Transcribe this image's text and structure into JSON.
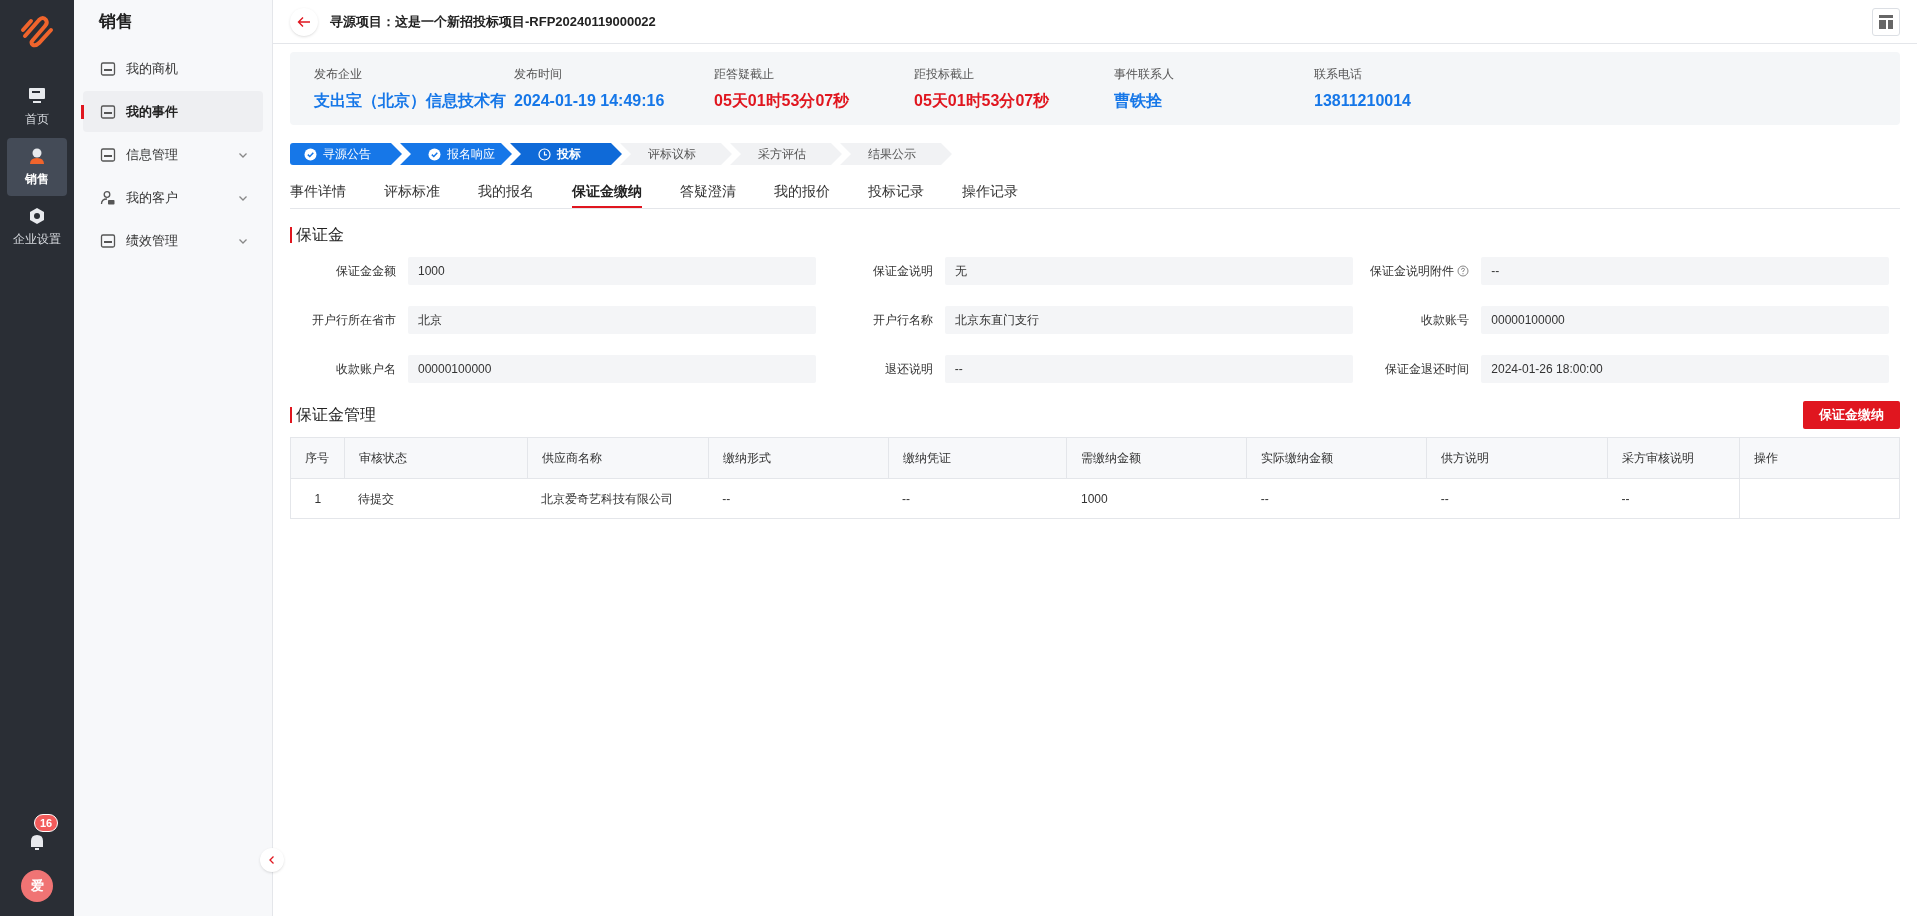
{
  "rail": {
    "items": [
      {
        "label": "首页",
        "selected": false
      },
      {
        "label": "销售",
        "selected": true
      },
      {
        "label": "企业设置",
        "selected": false
      }
    ],
    "notifications": {
      "count": "16"
    },
    "avatar": {
      "initial": "爱"
    }
  },
  "sidebar": {
    "title": "销售",
    "items": [
      {
        "label": "我的商机",
        "selected": false,
        "expandable": false
      },
      {
        "label": "我的事件",
        "selected": true,
        "expandable": false
      },
      {
        "label": "信息管理",
        "selected": false,
        "expandable": true
      },
      {
        "label": "我的客户",
        "selected": false,
        "expandable": true
      },
      {
        "label": "绩效管理",
        "selected": false,
        "expandable": true
      }
    ]
  },
  "header": {
    "title": "寻源项目：这是一个新招投标项目-RFP20240119000022"
  },
  "info": [
    {
      "label": "发布企业",
      "value": "支出宝（北京）信息技术有",
      "color": "#1677e8"
    },
    {
      "label": "发布时间",
      "value": "2024-01-19 14:49:16",
      "color": "#1677e8"
    },
    {
      "label": "距答疑截止",
      "value": "05天01时53分07秒",
      "color": "#e0161f"
    },
    {
      "label": "距投标截止",
      "value": "05天01时53分07秒",
      "color": "#e0161f"
    },
    {
      "label": "事件联系人",
      "value": "曹铁拴",
      "color": "#1677e8"
    },
    {
      "label": "联系电话",
      "value": "13811210014",
      "color": "#1677e8"
    }
  ],
  "steps": [
    {
      "label": "寻源公告",
      "done": true,
      "selected": false
    },
    {
      "label": "报名响应",
      "done": true,
      "selected": false
    },
    {
      "label": "投标",
      "done": false,
      "selected": true
    },
    {
      "label": "评标议标",
      "done": false,
      "selected": false
    },
    {
      "label": "采方评估",
      "done": false,
      "selected": false
    },
    {
      "label": "结果公示",
      "done": false,
      "selected": false
    }
  ],
  "tabs": [
    {
      "label": "事件详情",
      "selected": false
    },
    {
      "label": "评标标准",
      "selected": false
    },
    {
      "label": "我的报名",
      "selected": false
    },
    {
      "label": "保证金缴纳",
      "selected": true
    },
    {
      "label": "答疑澄清",
      "selected": false
    },
    {
      "label": "我的报价",
      "selected": false
    },
    {
      "label": "投标记录",
      "selected": false
    },
    {
      "label": "操作记录",
      "selected": false
    }
  ],
  "deposit": {
    "title": "保证金",
    "fields": [
      {
        "label": "保证金金额",
        "value": "1000",
        "help": false
      },
      {
        "label": "保证金说明",
        "value": "无",
        "help": false
      },
      {
        "label": "保证金说明附件",
        "value": "--",
        "help": true
      },
      {
        "label": "开户行所在省市",
        "value": "北京",
        "help": false
      },
      {
        "label": "开户行名称",
        "value": "北京东直门支行",
        "help": false
      },
      {
        "label": "收款账号",
        "value": "00000100000",
        "help": false
      },
      {
        "label": "收款账户名",
        "value": "00000100000",
        "help": false
      },
      {
        "label": "退还说明",
        "value": "--",
        "help": false
      },
      {
        "label": "保证金退还时间",
        "value": "2024-01-26 18:00:00",
        "help": false
      }
    ]
  },
  "management": {
    "title": "保证金管理",
    "button": "保证金缴纳",
    "table": {
      "columns": [
        "序号",
        "审核状态",
        "供应商名称",
        "缴纳形式",
        "缴纳凭证",
        "需缴纳金额",
        "实际缴纳金额",
        "供方说明",
        "采方审核说明",
        "操作"
      ],
      "rows": [
        [
          "1",
          "待提交",
          "北京爱奇艺科技有限公司",
          "--",
          "--",
          "1000",
          "--",
          "--",
          "--",
          null
        ]
      ]
    }
  }
}
